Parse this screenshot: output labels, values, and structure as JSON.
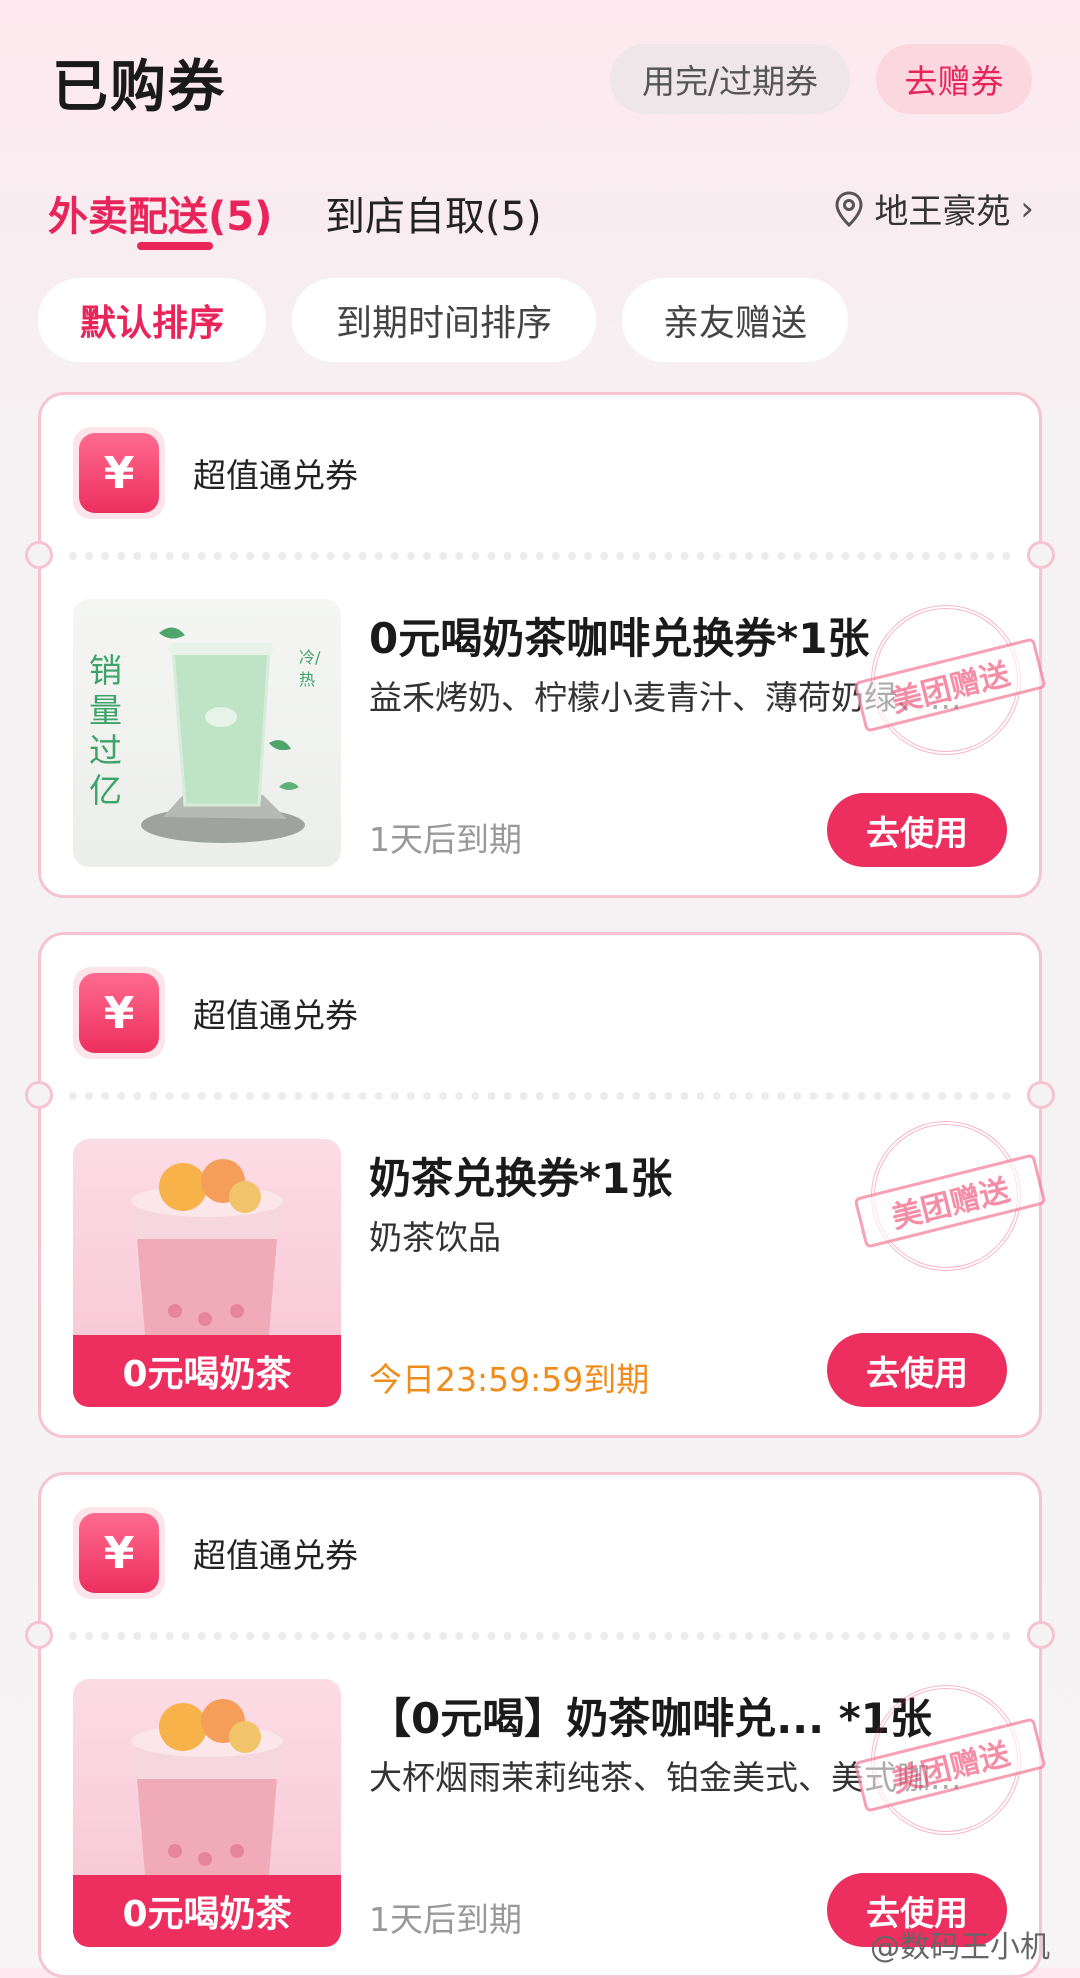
{
  "header": {
    "title": "已购券",
    "expired_label": "用完/过期券",
    "gift_label": "去赠券"
  },
  "tabs": [
    {
      "label": "外卖配送(5)"
    },
    {
      "label": "到店自取(5)"
    }
  ],
  "location": {
    "label": "地王豪苑",
    "chevron": "›"
  },
  "filters": [
    {
      "label": "默认排序"
    },
    {
      "label": "到期时间排序"
    },
    {
      "label": "亲友赠送"
    }
  ],
  "coupons": [
    {
      "type_label": "超值通兑券",
      "yen": "¥",
      "title": "0元喝奶茶咖啡兑换券*1张",
      "subtitle": "益禾烤奶、柠檬小麦青汁、薄荷奶绿、...",
      "thumb_text": "销量过亿",
      "thumb_tag": "冷/热",
      "expire": "1天后到期",
      "button": "去使用",
      "stamp": "美团赠送"
    },
    {
      "type_label": "超值通兑券",
      "yen": "¥",
      "title": "奶茶兑换券*1张",
      "subtitle": "奶茶饮品",
      "thumb_banner": "0元喝奶茶",
      "expire": "今日23:59:59到期",
      "button": "去使用",
      "stamp": "美团赠送"
    },
    {
      "type_label": "超值通兑券",
      "yen": "¥",
      "title": "【0元喝】奶茶咖啡兑...  *1张",
      "subtitle": "大杯烟雨茉莉纯茶、铂金美式、美式咖...",
      "thumb_banner": "0元喝奶茶",
      "expire": "1天后到期",
      "button": "去使用",
      "stamp": "美团赠送"
    }
  ],
  "watermark": "@数码王小机",
  "colors": {
    "accent": "#ec2f5e",
    "expire_today": "#f08c1c",
    "border": "#f6c3d1"
  }
}
